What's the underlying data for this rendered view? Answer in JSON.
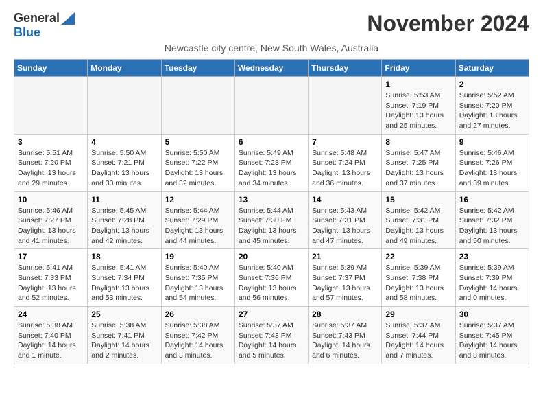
{
  "logo": {
    "part1": "General",
    "part2": "Blue"
  },
  "title": "November 2024",
  "subtitle": "Newcastle city centre, New South Wales, Australia",
  "weekdays": [
    "Sunday",
    "Monday",
    "Tuesday",
    "Wednesday",
    "Thursday",
    "Friday",
    "Saturday"
  ],
  "weeks": [
    [
      {
        "day": "",
        "info": ""
      },
      {
        "day": "",
        "info": ""
      },
      {
        "day": "",
        "info": ""
      },
      {
        "day": "",
        "info": ""
      },
      {
        "day": "",
        "info": ""
      },
      {
        "day": "1",
        "info": "Sunrise: 5:53 AM\nSunset: 7:19 PM\nDaylight: 13 hours\nand 25 minutes."
      },
      {
        "day": "2",
        "info": "Sunrise: 5:52 AM\nSunset: 7:20 PM\nDaylight: 13 hours\nand 27 minutes."
      }
    ],
    [
      {
        "day": "3",
        "info": "Sunrise: 5:51 AM\nSunset: 7:20 PM\nDaylight: 13 hours\nand 29 minutes."
      },
      {
        "day": "4",
        "info": "Sunrise: 5:50 AM\nSunset: 7:21 PM\nDaylight: 13 hours\nand 30 minutes."
      },
      {
        "day": "5",
        "info": "Sunrise: 5:50 AM\nSunset: 7:22 PM\nDaylight: 13 hours\nand 32 minutes."
      },
      {
        "day": "6",
        "info": "Sunrise: 5:49 AM\nSunset: 7:23 PM\nDaylight: 13 hours\nand 34 minutes."
      },
      {
        "day": "7",
        "info": "Sunrise: 5:48 AM\nSunset: 7:24 PM\nDaylight: 13 hours\nand 36 minutes."
      },
      {
        "day": "8",
        "info": "Sunrise: 5:47 AM\nSunset: 7:25 PM\nDaylight: 13 hours\nand 37 minutes."
      },
      {
        "day": "9",
        "info": "Sunrise: 5:46 AM\nSunset: 7:26 PM\nDaylight: 13 hours\nand 39 minutes."
      }
    ],
    [
      {
        "day": "10",
        "info": "Sunrise: 5:46 AM\nSunset: 7:27 PM\nDaylight: 13 hours\nand 41 minutes."
      },
      {
        "day": "11",
        "info": "Sunrise: 5:45 AM\nSunset: 7:28 PM\nDaylight: 13 hours\nand 42 minutes."
      },
      {
        "day": "12",
        "info": "Sunrise: 5:44 AM\nSunset: 7:29 PM\nDaylight: 13 hours\nand 44 minutes."
      },
      {
        "day": "13",
        "info": "Sunrise: 5:44 AM\nSunset: 7:30 PM\nDaylight: 13 hours\nand 45 minutes."
      },
      {
        "day": "14",
        "info": "Sunrise: 5:43 AM\nSunset: 7:31 PM\nDaylight: 13 hours\nand 47 minutes."
      },
      {
        "day": "15",
        "info": "Sunrise: 5:42 AM\nSunset: 7:31 PM\nDaylight: 13 hours\nand 49 minutes."
      },
      {
        "day": "16",
        "info": "Sunrise: 5:42 AM\nSunset: 7:32 PM\nDaylight: 13 hours\nand 50 minutes."
      }
    ],
    [
      {
        "day": "17",
        "info": "Sunrise: 5:41 AM\nSunset: 7:33 PM\nDaylight: 13 hours\nand 52 minutes."
      },
      {
        "day": "18",
        "info": "Sunrise: 5:41 AM\nSunset: 7:34 PM\nDaylight: 13 hours\nand 53 minutes."
      },
      {
        "day": "19",
        "info": "Sunrise: 5:40 AM\nSunset: 7:35 PM\nDaylight: 13 hours\nand 54 minutes."
      },
      {
        "day": "20",
        "info": "Sunrise: 5:40 AM\nSunset: 7:36 PM\nDaylight: 13 hours\nand 56 minutes."
      },
      {
        "day": "21",
        "info": "Sunrise: 5:39 AM\nSunset: 7:37 PM\nDaylight: 13 hours\nand 57 minutes."
      },
      {
        "day": "22",
        "info": "Sunrise: 5:39 AM\nSunset: 7:38 PM\nDaylight: 13 hours\nand 58 minutes."
      },
      {
        "day": "23",
        "info": "Sunrise: 5:39 AM\nSunset: 7:39 PM\nDaylight: 14 hours\nand 0 minutes."
      }
    ],
    [
      {
        "day": "24",
        "info": "Sunrise: 5:38 AM\nSunset: 7:40 PM\nDaylight: 14 hours\nand 1 minute."
      },
      {
        "day": "25",
        "info": "Sunrise: 5:38 AM\nSunset: 7:41 PM\nDaylight: 14 hours\nand 2 minutes."
      },
      {
        "day": "26",
        "info": "Sunrise: 5:38 AM\nSunset: 7:42 PM\nDaylight: 14 hours\nand 3 minutes."
      },
      {
        "day": "27",
        "info": "Sunrise: 5:37 AM\nSunset: 7:43 PM\nDaylight: 14 hours\nand 5 minutes."
      },
      {
        "day": "28",
        "info": "Sunrise: 5:37 AM\nSunset: 7:43 PM\nDaylight: 14 hours\nand 6 minutes."
      },
      {
        "day": "29",
        "info": "Sunrise: 5:37 AM\nSunset: 7:44 PM\nDaylight: 14 hours\nand 7 minutes."
      },
      {
        "day": "30",
        "info": "Sunrise: 5:37 AM\nSunset: 7:45 PM\nDaylight: 14 hours\nand 8 minutes."
      }
    ]
  ]
}
